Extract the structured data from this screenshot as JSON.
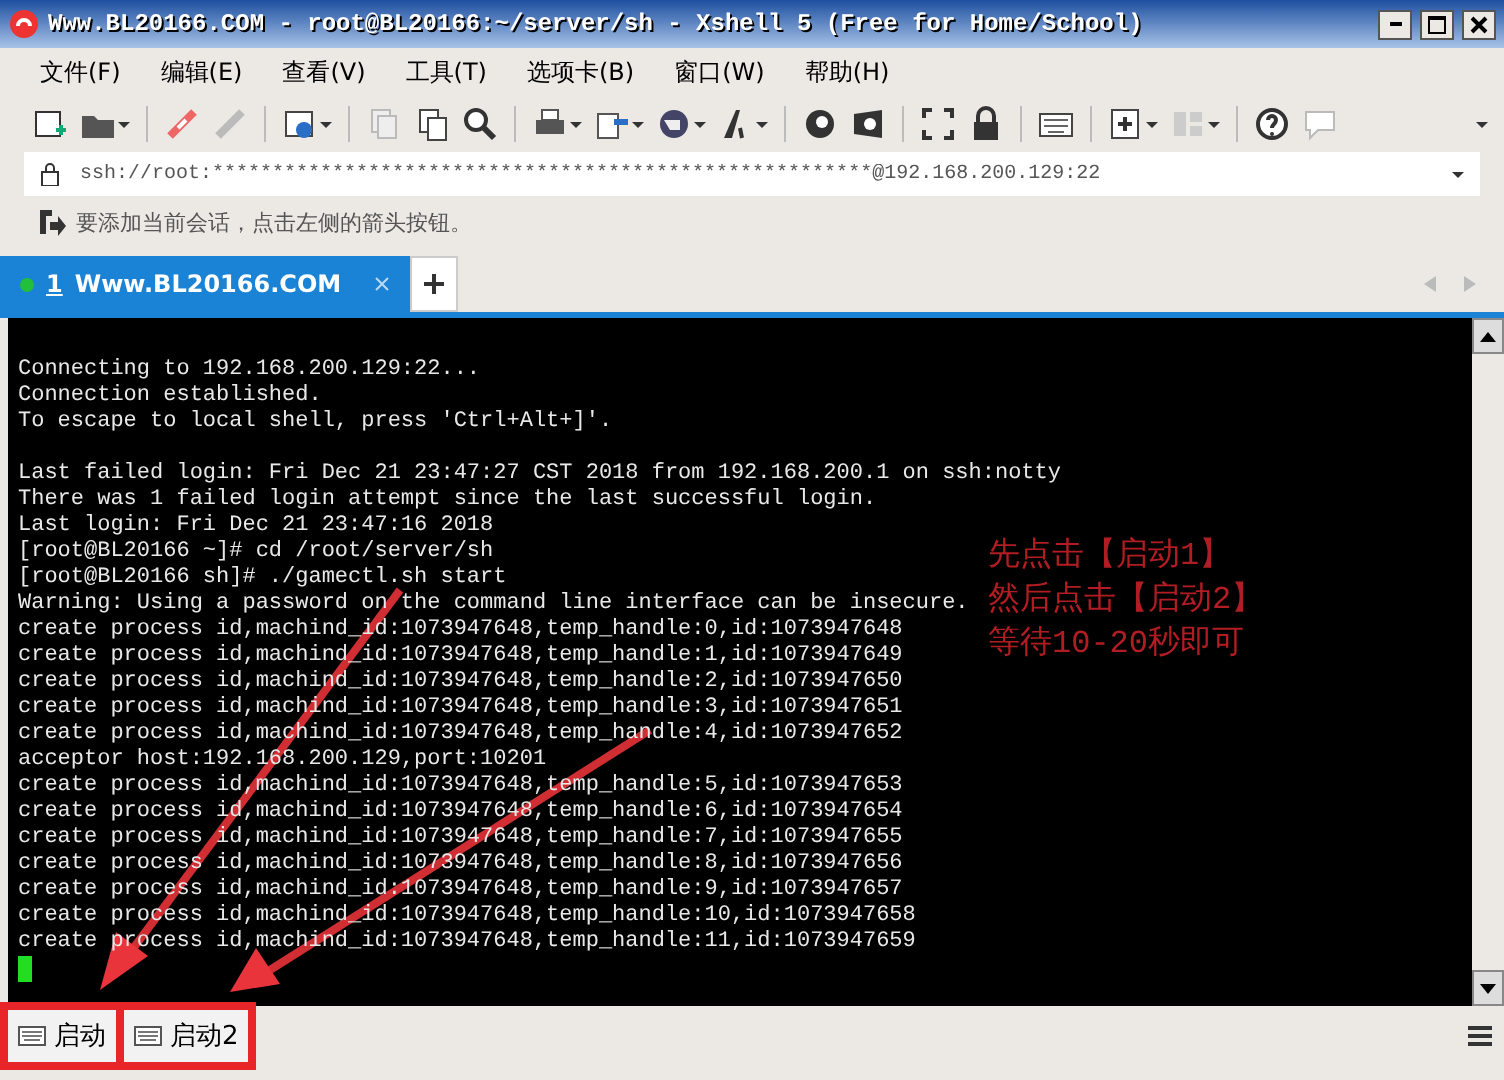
{
  "window": {
    "title": "Www.BL20166.COM - root@BL20166:~/server/sh - Xshell 5 (Free for Home/School)"
  },
  "menu": [
    "文件(F)",
    "编辑(E)",
    "查看(V)",
    "工具(T)",
    "选项卡(B)",
    "窗口(W)",
    "帮助(H)"
  ],
  "address_bar": {
    "value": "ssh://root:*******************************************************@192.168.200.129:22"
  },
  "session_hint": "要添加当前会话，点击左侧的箭头按钮。",
  "tabs": [
    {
      "number": "1",
      "label": "Www.BL20166.COM",
      "selected": true,
      "connected": true
    }
  ],
  "terminal": {
    "blocks": [
      [
        "Connecting to 192.168.200.129:22...",
        "Connection established.",
        "To escape to local shell, press 'Ctrl+Alt+]'."
      ],
      [
        "Last failed login: Fri Dec 21 23:47:27 CST 2018 from 192.168.200.1 on ssh:notty",
        "There was 1 failed login attempt since the last successful login.",
        "Last login: Fri Dec 21 23:47:16 2018",
        "[root@BL20166 ~]# cd /root/server/sh",
        "[root@BL20166 sh]# ./gamectl.sh start",
        "Warning: Using a password on the command line interface can be insecure.",
        "create process id,machind_id:1073947648,temp_handle:0,id:1073947648",
        "create process id,machind_id:1073947648,temp_handle:1,id:1073947649",
        "create process id,machind_id:1073947648,temp_handle:2,id:1073947650",
        "create process id,machind_id:1073947648,temp_handle:3,id:1073947651",
        "create process id,machind_id:1073947648,temp_handle:4,id:1073947652",
        "acceptor host:192.168.200.129,port:10201",
        "create process id,machind_id:1073947648,temp_handle:5,id:1073947653",
        "create process id,machind_id:1073947648,temp_handle:6,id:1073947654",
        "create process id,machind_id:1073947648,temp_handle:7,id:1073947655",
        "create process id,machind_id:1073947648,temp_handle:8,id:1073947656",
        "create process id,machind_id:1073947648,temp_handle:9,id:1073947657",
        "create process id,machind_id:1073947648,temp_handle:10,id:1073947658",
        "create process id,machind_id:1073947648,temp_handle:11,id:1073947659"
      ]
    ]
  },
  "annotation": {
    "lines": [
      "先点击【启动1】",
      "然后点击【启动2】",
      "等待10-20秒即可"
    ]
  },
  "quick_commands": [
    {
      "label": "启动",
      "highlighted": true
    },
    {
      "label": "启动2",
      "highlighted": true
    }
  ]
}
